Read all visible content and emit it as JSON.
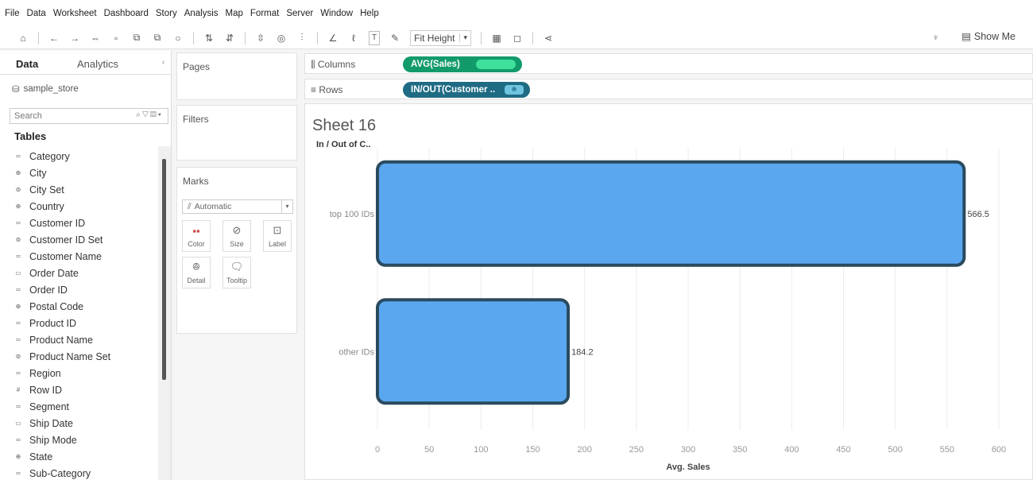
{
  "menu": [
    "File",
    "Data",
    "Worksheet",
    "Dashboard",
    "Story",
    "Analysis",
    "Map",
    "Format",
    "Server",
    "Window",
    "Help"
  ],
  "toolbar": {
    "fit": "Fit Height",
    "show_me": "Show Me",
    "icons": [
      "home-icon",
      "undo-icon",
      "redo-icon",
      "save-icon",
      "new-datasource-icon",
      "new-sheet-icon",
      "duplicate-icon",
      "clear-icon",
      "swap-icon",
      "sort-ascending-icon",
      "sort-descending-icon",
      "highlight-icon",
      "group-icon",
      "label-icon",
      "pin-icon",
      "presentation-icon",
      "tooltip-icon",
      "share-icon"
    ]
  },
  "data_pane": {
    "tab_data": "Data",
    "tab_analytics": "Analytics",
    "datasource": "sample_store",
    "search_placeholder": "Search",
    "tables_label": "Tables",
    "fields": [
      {
        "name": "Category",
        "icon": "abc-icon"
      },
      {
        "name": "City",
        "icon": "globe-icon"
      },
      {
        "name": "City Set",
        "icon": "set-icon"
      },
      {
        "name": "Country",
        "icon": "globe-icon"
      },
      {
        "name": "Customer ID",
        "icon": "abc-icon"
      },
      {
        "name": "Customer ID Set",
        "icon": "set-icon"
      },
      {
        "name": "Customer Name",
        "icon": "abc-icon"
      },
      {
        "name": "Order Date",
        "icon": "calendar-icon"
      },
      {
        "name": "Order ID",
        "icon": "abc-icon"
      },
      {
        "name": "Postal Code",
        "icon": "globe-icon"
      },
      {
        "name": "Product ID",
        "icon": "abc-icon"
      },
      {
        "name": "Product Name",
        "icon": "abc-icon"
      },
      {
        "name": "Product Name Set",
        "icon": "set-icon"
      },
      {
        "name": "Region",
        "icon": "abc-icon"
      },
      {
        "name": "Row ID",
        "icon": "number-icon"
      },
      {
        "name": "Segment",
        "icon": "abc-icon"
      },
      {
        "name": "Ship Date",
        "icon": "calendar-icon"
      },
      {
        "name": "Ship Mode",
        "icon": "abc-icon"
      },
      {
        "name": "State",
        "icon": "globe-icon"
      },
      {
        "name": "Sub-Category",
        "icon": "abc-icon"
      }
    ]
  },
  "cards": {
    "pages": "Pages",
    "filters": "Filters",
    "marks": "Marks",
    "mark_type": "Automatic",
    "mark_buttons": [
      "Color",
      "Size",
      "Label",
      "Detail",
      "Tooltip"
    ]
  },
  "shelves": {
    "columns_label": "Columns",
    "columns_pill": "AVG(Sales)",
    "rows_label": "Rows",
    "rows_pill": "IN/OUT(Customer .."
  },
  "sheet": {
    "title": "Sheet 16",
    "row_header": "In / Out of C.."
  },
  "colors": {
    "bar_fill": "#5aa7f0",
    "bar_border": "#2a4a5e",
    "columns_pill": "#129a6b",
    "rows_pill": "#1f6b84"
  },
  "chart_data": {
    "type": "bar",
    "orientation": "horizontal",
    "categories": [
      "top 100 IDs",
      "other IDs"
    ],
    "values": [
      566.5,
      184.2
    ],
    "value_labels": [
      "566.5",
      "184.2"
    ],
    "xlabel": "Avg. Sales",
    "xlim": [
      0,
      600
    ],
    "xticks": [
      0,
      50,
      100,
      150,
      200,
      250,
      300,
      350,
      400,
      450,
      500,
      550,
      600
    ],
    "grid": true
  }
}
